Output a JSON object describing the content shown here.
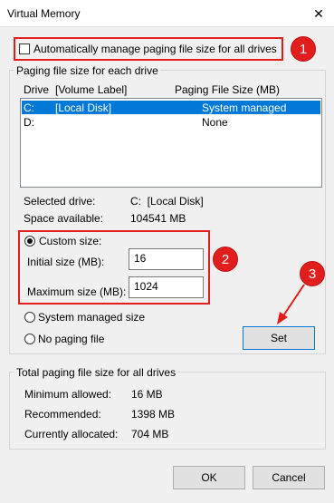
{
  "window": {
    "title": "Virtual Memory",
    "close_glyph": "✕"
  },
  "auto_manage": {
    "label": "Automatically manage paging file size for all drives",
    "checked": false
  },
  "paging_group": {
    "title": "Paging file size for each drive",
    "headers": {
      "drive": "Drive",
      "volume": "[Volume Label]",
      "size": "Paging File Size (MB)"
    },
    "rows": [
      {
        "drive": "C:",
        "volume": "[Local Disk]",
        "size": "System managed",
        "selected": true
      },
      {
        "drive": "D:",
        "volume": "",
        "size": "None",
        "selected": false
      }
    ],
    "selected_drive_label": "Selected drive:",
    "selected_drive_value": "C:  [Local Disk]",
    "space_label": "Space available:",
    "space_value": "104541 MB",
    "custom_size_label": "Custom size:",
    "initial_label": "Initial size (MB):",
    "initial_value": "16",
    "maximum_label": "Maximum size (MB):",
    "maximum_value": "1024",
    "system_managed_label": "System managed size",
    "no_paging_label": "No paging file",
    "set_label": "Set"
  },
  "totals_group": {
    "title": "Total paging file size for all drives",
    "min_label": "Minimum allowed:",
    "min_value": "16 MB",
    "rec_label": "Recommended:",
    "rec_value": "1398 MB",
    "alloc_label": "Currently allocated:",
    "alloc_value": "704 MB"
  },
  "buttons": {
    "ok": "OK",
    "cancel": "Cancel"
  },
  "annotations": {
    "step1": "1",
    "step2": "2",
    "step3": "3",
    "color": "#e11d1d"
  }
}
